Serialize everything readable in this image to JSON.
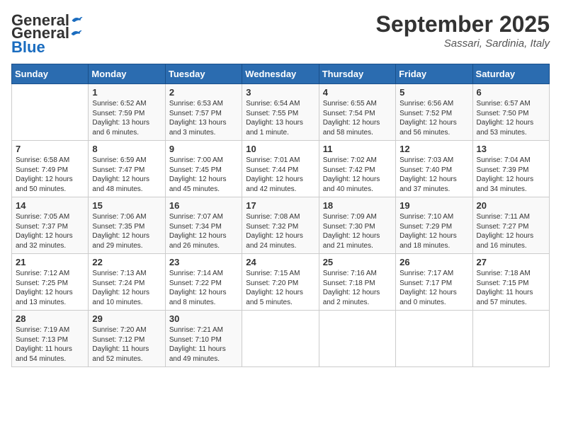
{
  "logo": {
    "general": "General",
    "blue": "Blue"
  },
  "title": "September 2025",
  "location": "Sassari, Sardinia, Italy",
  "days_of_week": [
    "Sunday",
    "Monday",
    "Tuesday",
    "Wednesday",
    "Thursday",
    "Friday",
    "Saturday"
  ],
  "weeks": [
    [
      {
        "day": "",
        "sunrise": "",
        "sunset": "",
        "daylight": ""
      },
      {
        "day": "1",
        "sunrise": "Sunrise: 6:52 AM",
        "sunset": "Sunset: 7:59 PM",
        "daylight": "Daylight: 13 hours and 6 minutes."
      },
      {
        "day": "2",
        "sunrise": "Sunrise: 6:53 AM",
        "sunset": "Sunset: 7:57 PM",
        "daylight": "Daylight: 13 hours and 3 minutes."
      },
      {
        "day": "3",
        "sunrise": "Sunrise: 6:54 AM",
        "sunset": "Sunset: 7:55 PM",
        "daylight": "Daylight: 13 hours and 1 minute."
      },
      {
        "day": "4",
        "sunrise": "Sunrise: 6:55 AM",
        "sunset": "Sunset: 7:54 PM",
        "daylight": "Daylight: 12 hours and 58 minutes."
      },
      {
        "day": "5",
        "sunrise": "Sunrise: 6:56 AM",
        "sunset": "Sunset: 7:52 PM",
        "daylight": "Daylight: 12 hours and 56 minutes."
      },
      {
        "day": "6",
        "sunrise": "Sunrise: 6:57 AM",
        "sunset": "Sunset: 7:50 PM",
        "daylight": "Daylight: 12 hours and 53 minutes."
      }
    ],
    [
      {
        "day": "7",
        "sunrise": "Sunrise: 6:58 AM",
        "sunset": "Sunset: 7:49 PM",
        "daylight": "Daylight: 12 hours and 50 minutes."
      },
      {
        "day": "8",
        "sunrise": "Sunrise: 6:59 AM",
        "sunset": "Sunset: 7:47 PM",
        "daylight": "Daylight: 12 hours and 48 minutes."
      },
      {
        "day": "9",
        "sunrise": "Sunrise: 7:00 AM",
        "sunset": "Sunset: 7:45 PM",
        "daylight": "Daylight: 12 hours and 45 minutes."
      },
      {
        "day": "10",
        "sunrise": "Sunrise: 7:01 AM",
        "sunset": "Sunset: 7:44 PM",
        "daylight": "Daylight: 12 hours and 42 minutes."
      },
      {
        "day": "11",
        "sunrise": "Sunrise: 7:02 AM",
        "sunset": "Sunset: 7:42 PM",
        "daylight": "Daylight: 12 hours and 40 minutes."
      },
      {
        "day": "12",
        "sunrise": "Sunrise: 7:03 AM",
        "sunset": "Sunset: 7:40 PM",
        "daylight": "Daylight: 12 hours and 37 minutes."
      },
      {
        "day": "13",
        "sunrise": "Sunrise: 7:04 AM",
        "sunset": "Sunset: 7:39 PM",
        "daylight": "Daylight: 12 hours and 34 minutes."
      }
    ],
    [
      {
        "day": "14",
        "sunrise": "Sunrise: 7:05 AM",
        "sunset": "Sunset: 7:37 PM",
        "daylight": "Daylight: 12 hours and 32 minutes."
      },
      {
        "day": "15",
        "sunrise": "Sunrise: 7:06 AM",
        "sunset": "Sunset: 7:35 PM",
        "daylight": "Daylight: 12 hours and 29 minutes."
      },
      {
        "day": "16",
        "sunrise": "Sunrise: 7:07 AM",
        "sunset": "Sunset: 7:34 PM",
        "daylight": "Daylight: 12 hours and 26 minutes."
      },
      {
        "day": "17",
        "sunrise": "Sunrise: 7:08 AM",
        "sunset": "Sunset: 7:32 PM",
        "daylight": "Daylight: 12 hours and 24 minutes."
      },
      {
        "day": "18",
        "sunrise": "Sunrise: 7:09 AM",
        "sunset": "Sunset: 7:30 PM",
        "daylight": "Daylight: 12 hours and 21 minutes."
      },
      {
        "day": "19",
        "sunrise": "Sunrise: 7:10 AM",
        "sunset": "Sunset: 7:29 PM",
        "daylight": "Daylight: 12 hours and 18 minutes."
      },
      {
        "day": "20",
        "sunrise": "Sunrise: 7:11 AM",
        "sunset": "Sunset: 7:27 PM",
        "daylight": "Daylight: 12 hours and 16 minutes."
      }
    ],
    [
      {
        "day": "21",
        "sunrise": "Sunrise: 7:12 AM",
        "sunset": "Sunset: 7:25 PM",
        "daylight": "Daylight: 12 hours and 13 minutes."
      },
      {
        "day": "22",
        "sunrise": "Sunrise: 7:13 AM",
        "sunset": "Sunset: 7:24 PM",
        "daylight": "Daylight: 12 hours and 10 minutes."
      },
      {
        "day": "23",
        "sunrise": "Sunrise: 7:14 AM",
        "sunset": "Sunset: 7:22 PM",
        "daylight": "Daylight: 12 hours and 8 minutes."
      },
      {
        "day": "24",
        "sunrise": "Sunrise: 7:15 AM",
        "sunset": "Sunset: 7:20 PM",
        "daylight": "Daylight: 12 hours and 5 minutes."
      },
      {
        "day": "25",
        "sunrise": "Sunrise: 7:16 AM",
        "sunset": "Sunset: 7:18 PM",
        "daylight": "Daylight: 12 hours and 2 minutes."
      },
      {
        "day": "26",
        "sunrise": "Sunrise: 7:17 AM",
        "sunset": "Sunset: 7:17 PM",
        "daylight": "Daylight: 12 hours and 0 minutes."
      },
      {
        "day": "27",
        "sunrise": "Sunrise: 7:18 AM",
        "sunset": "Sunset: 7:15 PM",
        "daylight": "Daylight: 11 hours and 57 minutes."
      }
    ],
    [
      {
        "day": "28",
        "sunrise": "Sunrise: 7:19 AM",
        "sunset": "Sunset: 7:13 PM",
        "daylight": "Daylight: 11 hours and 54 minutes."
      },
      {
        "day": "29",
        "sunrise": "Sunrise: 7:20 AM",
        "sunset": "Sunset: 7:12 PM",
        "daylight": "Daylight: 11 hours and 52 minutes."
      },
      {
        "day": "30",
        "sunrise": "Sunrise: 7:21 AM",
        "sunset": "Sunset: 7:10 PM",
        "daylight": "Daylight: 11 hours and 49 minutes."
      },
      {
        "day": "",
        "sunrise": "",
        "sunset": "",
        "daylight": ""
      },
      {
        "day": "",
        "sunrise": "",
        "sunset": "",
        "daylight": ""
      },
      {
        "day": "",
        "sunrise": "",
        "sunset": "",
        "daylight": ""
      },
      {
        "day": "",
        "sunrise": "",
        "sunset": "",
        "daylight": ""
      }
    ]
  ]
}
